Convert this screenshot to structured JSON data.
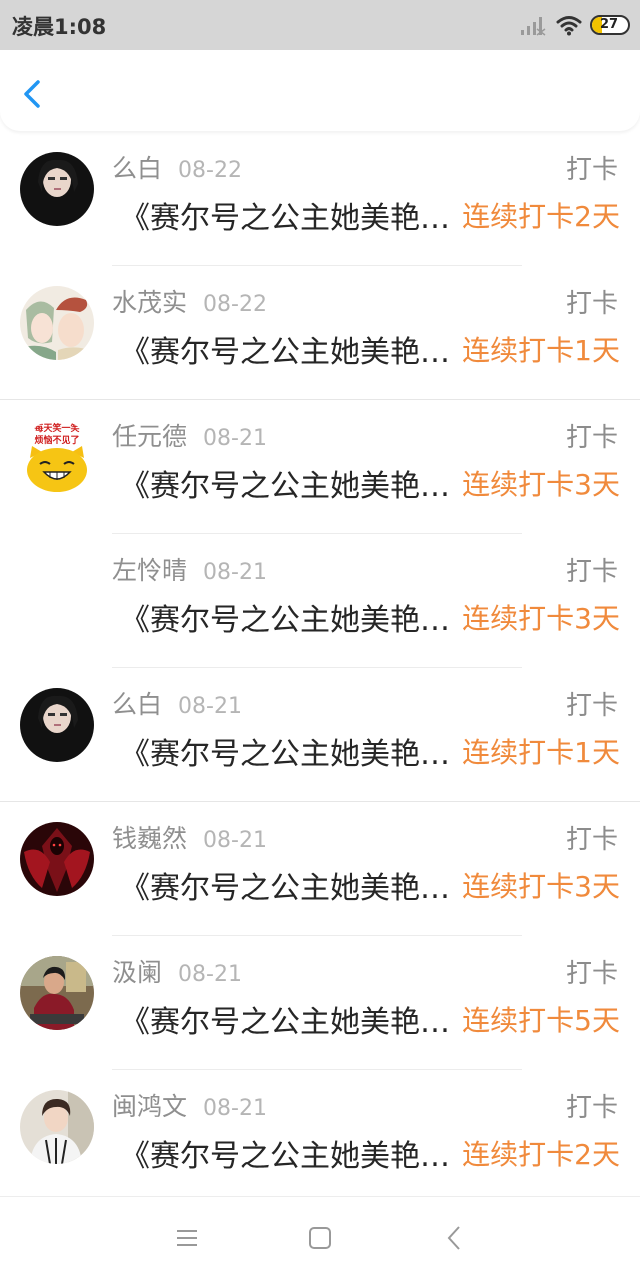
{
  "status_bar": {
    "time": "凌晨1:08",
    "battery": "27",
    "battery_level": 0.27,
    "icons": [
      "signal-icon",
      "wifi-icon",
      "battery-icon"
    ]
  },
  "header": {
    "back_icon": "chevron-left-icon",
    "accent_color": "#2196f3"
  },
  "feed": [
    {
      "name": "么白",
      "date": "08-22",
      "label": "打卡",
      "title": "《赛尔号之公主她美艳…",
      "streak": "连续打卡2天"
    },
    {
      "name": "水茂实",
      "date": "08-22",
      "label": "打卡",
      "title": "《赛尔号之公主她美艳…",
      "streak": "连续打卡1天"
    },
    {
      "name": "任元德",
      "date": "08-21",
      "label": "打卡",
      "title": "《赛尔号之公主她美艳…",
      "streak": "连续打卡3天",
      "avatar_text": [
        "每天笑一笑",
        "烦恼不见了"
      ]
    },
    {
      "name": "左怜晴",
      "date": "08-21",
      "label": "打卡",
      "title": "《赛尔号之公主她美艳…",
      "streak": "连续打卡3天"
    },
    {
      "name": "么白",
      "date": "08-21",
      "label": "打卡",
      "title": "《赛尔号之公主她美艳…",
      "streak": "连续打卡1天"
    },
    {
      "name": "钱巍然",
      "date": "08-21",
      "label": "打卡",
      "title": "《赛尔号之公主她美艳…",
      "streak": "连续打卡3天"
    },
    {
      "name": "汲阑",
      "date": "08-21",
      "label": "打卡",
      "title": "《赛尔号之公主她美艳…",
      "streak": "连续打卡5天"
    },
    {
      "name": "闽鸿文",
      "date": "08-21",
      "label": "打卡",
      "title": "《赛尔号之公主她美艳…",
      "streak": "连续打卡2天"
    }
  ],
  "colors": {
    "streak": "#f08a3c",
    "status_bar_bg": "#d6d6d6",
    "name": "#8f8f8f"
  },
  "nav_bar": {
    "icons": [
      "menu-icon",
      "home-square-icon",
      "back-triangle-icon"
    ]
  }
}
